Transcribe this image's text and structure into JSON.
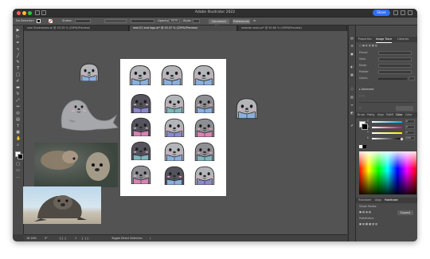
{
  "window": {
    "title": "Adobe Illustrator 2022",
    "share_label": "Share",
    "traffic_colors": [
      "#fe5f57",
      "#febc2e",
      "#28c840"
    ]
  },
  "control_bar": {
    "selection_label": "No Selection",
    "stroke_label": "Stroke:",
    "opacity_label": "Opacity:",
    "opacity_value": "100%",
    "style_label": "Style:",
    "document_setup": "Document Setup",
    "preferences": "Preferences"
  },
  "tabs": [
    {
      "label": "seal Illustrations.ai @ 33.33 % (CMYK/Preview)",
      "active": false
    },
    {
      "label": "seal-01 and logo.ai* @ 43.37 % (CMYK/Preview)",
      "active": true
    },
    {
      "label": "website seals.ai* @ 50.66 % (CMYK/Preview)",
      "active": false
    }
  ],
  "status": {
    "zoom": "18.18%",
    "angle": "0°",
    "page": "1",
    "tool_status": "Toggle Direct Selection"
  },
  "panel": {
    "top_tabs": [
      "Properties",
      "Image Trace",
      "Libraries"
    ],
    "active_top_tab": "Image Trace",
    "trace_rows": [
      "Preset:",
      "View:",
      "Mode:",
      "Palette:",
      "Colors:"
    ],
    "advanced_label": "Advanced",
    "swatch_tabs": [
      "Color",
      "Swatches",
      "Stroke",
      "Gradient"
    ],
    "color_tabs": [
      "Brush",
      "Pathg",
      "Align",
      "Pathfi",
      "Color",
      "Color"
    ],
    "active_color_tab": "Color",
    "channels": [
      "C",
      "M",
      "Y",
      "K"
    ],
    "channel_values": [
      "0",
      "0",
      "0",
      "100"
    ],
    "bottom_tabs": [
      "Transform",
      "Align",
      "Pathfinder"
    ],
    "active_bottom_tab": "Pathfinder",
    "shape_modes_label": "Shape Modes:",
    "pathfinders_label": "Pathfinders:",
    "expand_label": "Expand"
  },
  "tools": [
    "selection-tool",
    "direct-selection-tool",
    "pen-tool",
    "curvature-tool",
    "line-tool",
    "pencil-tool",
    "type-tool",
    "rectangle-tool",
    "brush-tool",
    "eraser-tool",
    "rotate-tool",
    "scale-tool",
    "width-tool",
    "shape-builder-tool",
    "gradient-tool",
    "eyedropper-tool",
    "artboard-tool",
    "hand-tool",
    "zoom-tool",
    "fill-stroke-swatch",
    "screen-mode-tool"
  ],
  "colors": {
    "seal_gray": "#8e8f93",
    "seal_dark": "#55545d",
    "seal_light": "#b4b5b9",
    "book_blue": "#8ab0de",
    "book_purple": "#8b89c9",
    "book_pink": "#d783b4",
    "book_teal": "#7fb6bd",
    "cheek": "#e9a5c2"
  }
}
